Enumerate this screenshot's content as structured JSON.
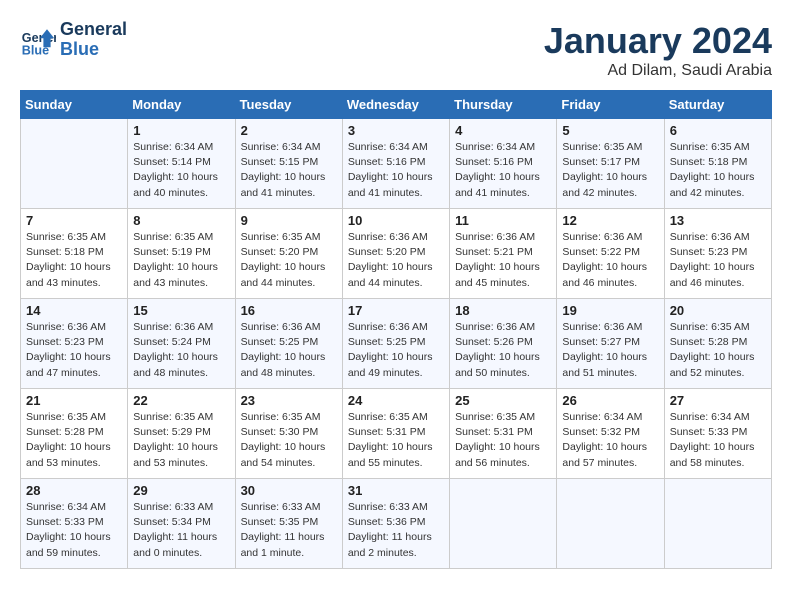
{
  "header": {
    "logo_line1": "General",
    "logo_line2": "Blue",
    "month": "January 2024",
    "location": "Ad Dilam, Saudi Arabia"
  },
  "weekdays": [
    "Sunday",
    "Monday",
    "Tuesday",
    "Wednesday",
    "Thursday",
    "Friday",
    "Saturday"
  ],
  "weeks": [
    [
      {
        "day": "",
        "info": ""
      },
      {
        "day": "1",
        "info": "Sunrise: 6:34 AM\nSunset: 5:14 PM\nDaylight: 10 hours\nand 40 minutes."
      },
      {
        "day": "2",
        "info": "Sunrise: 6:34 AM\nSunset: 5:15 PM\nDaylight: 10 hours\nand 41 minutes."
      },
      {
        "day": "3",
        "info": "Sunrise: 6:34 AM\nSunset: 5:16 PM\nDaylight: 10 hours\nand 41 minutes."
      },
      {
        "day": "4",
        "info": "Sunrise: 6:34 AM\nSunset: 5:16 PM\nDaylight: 10 hours\nand 41 minutes."
      },
      {
        "day": "5",
        "info": "Sunrise: 6:35 AM\nSunset: 5:17 PM\nDaylight: 10 hours\nand 42 minutes."
      },
      {
        "day": "6",
        "info": "Sunrise: 6:35 AM\nSunset: 5:18 PM\nDaylight: 10 hours\nand 42 minutes."
      }
    ],
    [
      {
        "day": "7",
        "info": "Sunrise: 6:35 AM\nSunset: 5:18 PM\nDaylight: 10 hours\nand 43 minutes."
      },
      {
        "day": "8",
        "info": "Sunrise: 6:35 AM\nSunset: 5:19 PM\nDaylight: 10 hours\nand 43 minutes."
      },
      {
        "day": "9",
        "info": "Sunrise: 6:35 AM\nSunset: 5:20 PM\nDaylight: 10 hours\nand 44 minutes."
      },
      {
        "day": "10",
        "info": "Sunrise: 6:36 AM\nSunset: 5:20 PM\nDaylight: 10 hours\nand 44 minutes."
      },
      {
        "day": "11",
        "info": "Sunrise: 6:36 AM\nSunset: 5:21 PM\nDaylight: 10 hours\nand 45 minutes."
      },
      {
        "day": "12",
        "info": "Sunrise: 6:36 AM\nSunset: 5:22 PM\nDaylight: 10 hours\nand 46 minutes."
      },
      {
        "day": "13",
        "info": "Sunrise: 6:36 AM\nSunset: 5:23 PM\nDaylight: 10 hours\nand 46 minutes."
      }
    ],
    [
      {
        "day": "14",
        "info": "Sunrise: 6:36 AM\nSunset: 5:23 PM\nDaylight: 10 hours\nand 47 minutes."
      },
      {
        "day": "15",
        "info": "Sunrise: 6:36 AM\nSunset: 5:24 PM\nDaylight: 10 hours\nand 48 minutes."
      },
      {
        "day": "16",
        "info": "Sunrise: 6:36 AM\nSunset: 5:25 PM\nDaylight: 10 hours\nand 48 minutes."
      },
      {
        "day": "17",
        "info": "Sunrise: 6:36 AM\nSunset: 5:25 PM\nDaylight: 10 hours\nand 49 minutes."
      },
      {
        "day": "18",
        "info": "Sunrise: 6:36 AM\nSunset: 5:26 PM\nDaylight: 10 hours\nand 50 minutes."
      },
      {
        "day": "19",
        "info": "Sunrise: 6:36 AM\nSunset: 5:27 PM\nDaylight: 10 hours\nand 51 minutes."
      },
      {
        "day": "20",
        "info": "Sunrise: 6:35 AM\nSunset: 5:28 PM\nDaylight: 10 hours\nand 52 minutes."
      }
    ],
    [
      {
        "day": "21",
        "info": "Sunrise: 6:35 AM\nSunset: 5:28 PM\nDaylight: 10 hours\nand 53 minutes."
      },
      {
        "day": "22",
        "info": "Sunrise: 6:35 AM\nSunset: 5:29 PM\nDaylight: 10 hours\nand 53 minutes."
      },
      {
        "day": "23",
        "info": "Sunrise: 6:35 AM\nSunset: 5:30 PM\nDaylight: 10 hours\nand 54 minutes."
      },
      {
        "day": "24",
        "info": "Sunrise: 6:35 AM\nSunset: 5:31 PM\nDaylight: 10 hours\nand 55 minutes."
      },
      {
        "day": "25",
        "info": "Sunrise: 6:35 AM\nSunset: 5:31 PM\nDaylight: 10 hours\nand 56 minutes."
      },
      {
        "day": "26",
        "info": "Sunrise: 6:34 AM\nSunset: 5:32 PM\nDaylight: 10 hours\nand 57 minutes."
      },
      {
        "day": "27",
        "info": "Sunrise: 6:34 AM\nSunset: 5:33 PM\nDaylight: 10 hours\nand 58 minutes."
      }
    ],
    [
      {
        "day": "28",
        "info": "Sunrise: 6:34 AM\nSunset: 5:33 PM\nDaylight: 10 hours\nand 59 minutes."
      },
      {
        "day": "29",
        "info": "Sunrise: 6:33 AM\nSunset: 5:34 PM\nDaylight: 11 hours\nand 0 minutes."
      },
      {
        "day": "30",
        "info": "Sunrise: 6:33 AM\nSunset: 5:35 PM\nDaylight: 11 hours\nand 1 minute."
      },
      {
        "day": "31",
        "info": "Sunrise: 6:33 AM\nSunset: 5:36 PM\nDaylight: 11 hours\nand 2 minutes."
      },
      {
        "day": "",
        "info": ""
      },
      {
        "day": "",
        "info": ""
      },
      {
        "day": "",
        "info": ""
      }
    ]
  ]
}
